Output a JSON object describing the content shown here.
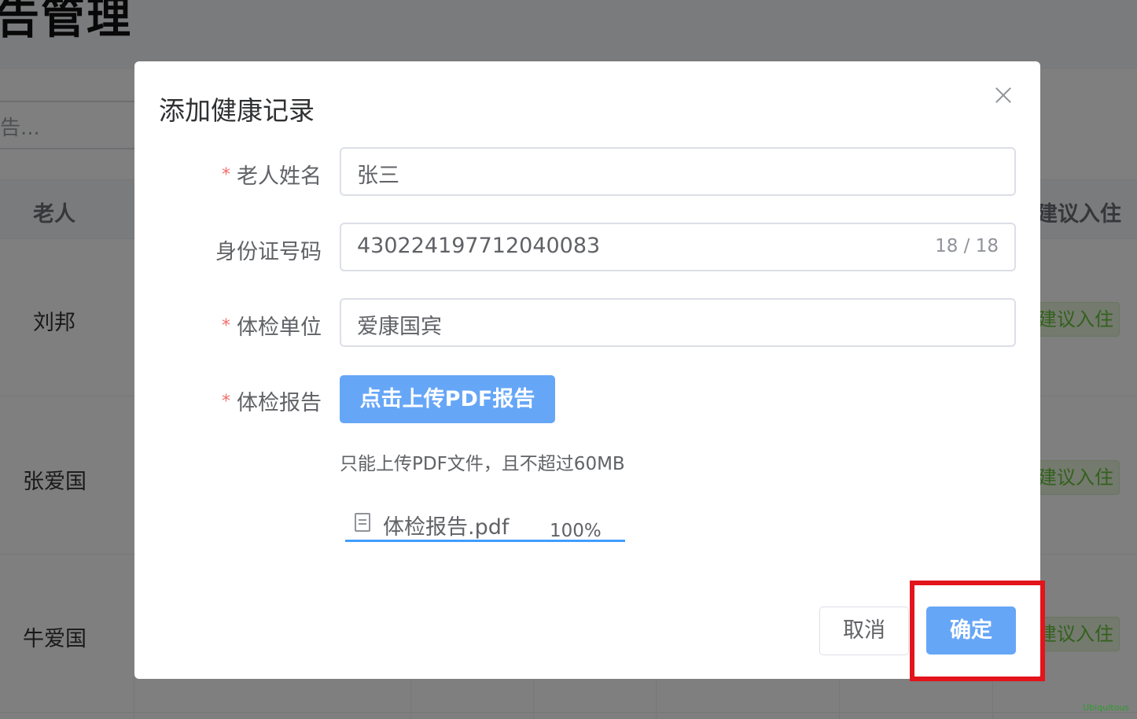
{
  "background": {
    "page_title": "告管理",
    "search_placeholder": "告...",
    "table_headers": {
      "left": "老人",
      "right": "建议入住"
    },
    "rows": [
      {
        "name": "刘邦",
        "action": "建议入住"
      },
      {
        "name": "张爱国",
        "action": "建议入住"
      },
      {
        "name": "牛爱国",
        "action": "建议入住"
      }
    ],
    "watermark": "Ubiquitous"
  },
  "dialog": {
    "title": "添加健康记录",
    "fields": {
      "elder_name": {
        "label": "老人姓名",
        "required": true,
        "value": "张三"
      },
      "id_number": {
        "label": "身份证号码",
        "required": false,
        "value": "430224197712040083",
        "count": "18 / 18"
      },
      "exam_unit": {
        "label": "体检单位",
        "required": true,
        "value": "爱康国宾"
      },
      "exam_report": {
        "label": "体检报告",
        "required": true
      }
    },
    "upload": {
      "button_label": "点击上传PDF报告",
      "tip": "只能上传PDF文件，且不超过60MB",
      "file_name": "体检报告.pdf",
      "progress_text": "100%",
      "progress": 1.0
    },
    "buttons": {
      "cancel": "取消",
      "confirm": "确定"
    }
  },
  "colors": {
    "primary": "#66a6f7",
    "required_asterisk": "#f56c6c",
    "highlight_box": "#e3141b",
    "success": "#67c23a"
  },
  "icons": {
    "close": "close-icon",
    "file": "document-icon"
  }
}
